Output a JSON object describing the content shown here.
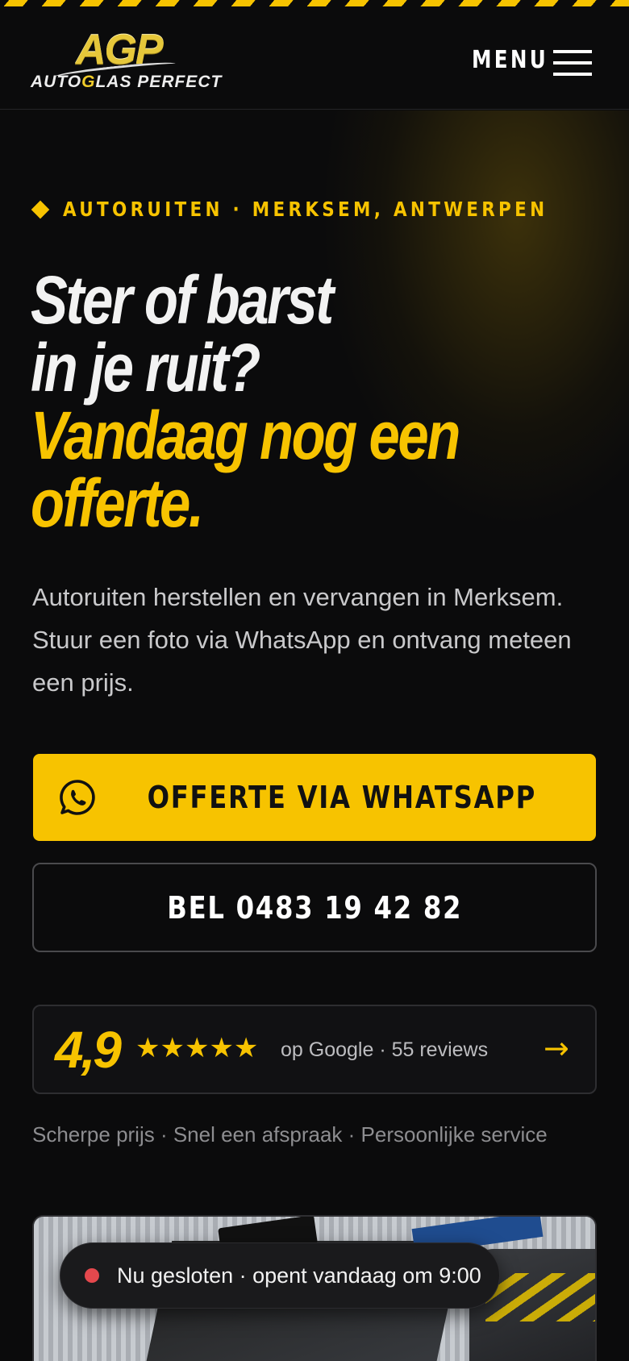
{
  "header": {
    "logo_mark": "AGP",
    "logo_brand_a": "AUTO",
    "logo_brand_g": "G",
    "logo_brand_b": "LAS PERFECT",
    "menu_label": "MENU"
  },
  "hero": {
    "eyebrow": "AUTORUITEN · MERKSEM, ANTWERPEN",
    "headline_lines": [
      "Ster of barst",
      "in je ruit?",
      "Vandaag nog een",
      "offerte."
    ],
    "lead": "Autoruiten herstellen en vervangen in Merksem. Stuur een foto via WhatsApp en ontvang meteen een prijs.",
    "whatsapp_button": "OFFERTE VIA WHATSAPP",
    "call_button": "BEL 0483 19 42 82"
  },
  "rating": {
    "score": "4,9",
    "stars": "★★★★★",
    "stars_value": 5,
    "info": "op Google · 55 reviews",
    "arrow": "→"
  },
  "perks": "Scherpe prijs · Snel een afspraak · Persoonlijke service",
  "status": {
    "text": "Nu gesloten · opent vandaag om 9:00",
    "indicator_color": "#e5484d"
  },
  "colors": {
    "accent": "#f7c300",
    "background": "#0b0b0c"
  },
  "icons": {
    "whatsapp": "whatsapp-icon",
    "menu": "hamburger-icon",
    "eyebrow": "diamond-icon"
  }
}
